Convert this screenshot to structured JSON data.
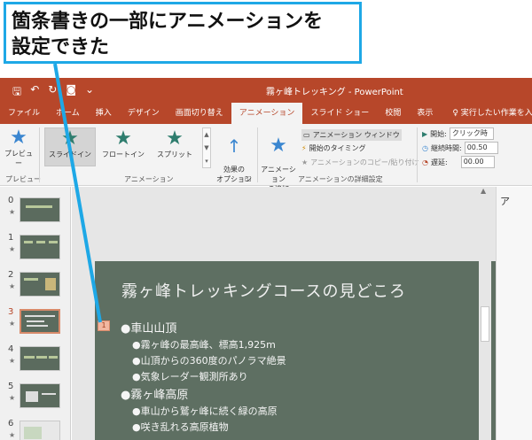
{
  "callout": {
    "line1": "箇条書きの一部にアニメーションを",
    "line2": "設定できた"
  },
  "window": {
    "title": "霧ヶ峰トレッキング - PowerPoint",
    "qat": [
      "🖫",
      "↶",
      "↻",
      "◙",
      "⌄"
    ]
  },
  "tabs": [
    {
      "label": "ファイル",
      "active": false
    },
    {
      "label": "ホーム",
      "active": false
    },
    {
      "label": "挿入",
      "active": false
    },
    {
      "label": "デザイン",
      "active": false
    },
    {
      "label": "画面切り替え",
      "active": false
    },
    {
      "label": "アニメーション",
      "active": true
    },
    {
      "label": "スライド ショー",
      "active": false
    },
    {
      "label": "校閲",
      "active": false
    },
    {
      "label": "表示",
      "active": false
    },
    {
      "label": "♀ 実行したい作業を入力し",
      "active": false
    }
  ],
  "ribbon": {
    "preview": {
      "label": "プレビュー",
      "group": "プレビュー"
    },
    "animations": {
      "group": "アニメーション",
      "items": [
        "スライドイン",
        "フロートイン",
        "スプリット"
      ],
      "effect_options": "効果の\nオプション"
    },
    "advanced": {
      "group": "アニメーションの詳細設定",
      "add_animation": "アニメーション\nの追加",
      "animation_pane": "アニメーション ウィンドウ",
      "trigger": "開始のタイミング",
      "painter": "アニメーションのコピー/貼り付け"
    },
    "timing": {
      "start_label": "開始:",
      "start_value": "クリック時",
      "duration_label": "継続時間:",
      "duration_value": "00.50",
      "delay_label": "遅延:",
      "delay_value": "00.00"
    }
  },
  "thumbnails": [
    {
      "num": "0",
      "star": "★"
    },
    {
      "num": "1",
      "star": "★"
    },
    {
      "num": "2",
      "star": "★"
    },
    {
      "num": "3",
      "star": "★"
    },
    {
      "num": "4",
      "star": "★"
    },
    {
      "num": "5",
      "star": "★"
    },
    {
      "num": "6",
      "star": "★"
    }
  ],
  "slide": {
    "title": "霧ヶ峰トレッキングコースの見どころ",
    "anim_tag": "1",
    "bullets": [
      {
        "level": 1,
        "text": "●車山山頂"
      },
      {
        "level": 2,
        "text": "●霧ヶ峰の最高峰、標高1,925m"
      },
      {
        "level": 2,
        "text": "●山頂からの360度のパノラマ絶景"
      },
      {
        "level": 2,
        "text": "●気象レーダー観測所あり"
      },
      {
        "level": 1,
        "text": "●霧ヶ峰高原"
      },
      {
        "level": 2,
        "text": "●車山から鷲ヶ峰に続く緑の高原"
      },
      {
        "level": 2,
        "text": "●咲き乱れる高原植物"
      }
    ]
  },
  "rightpane": {
    "label": "ア"
  }
}
